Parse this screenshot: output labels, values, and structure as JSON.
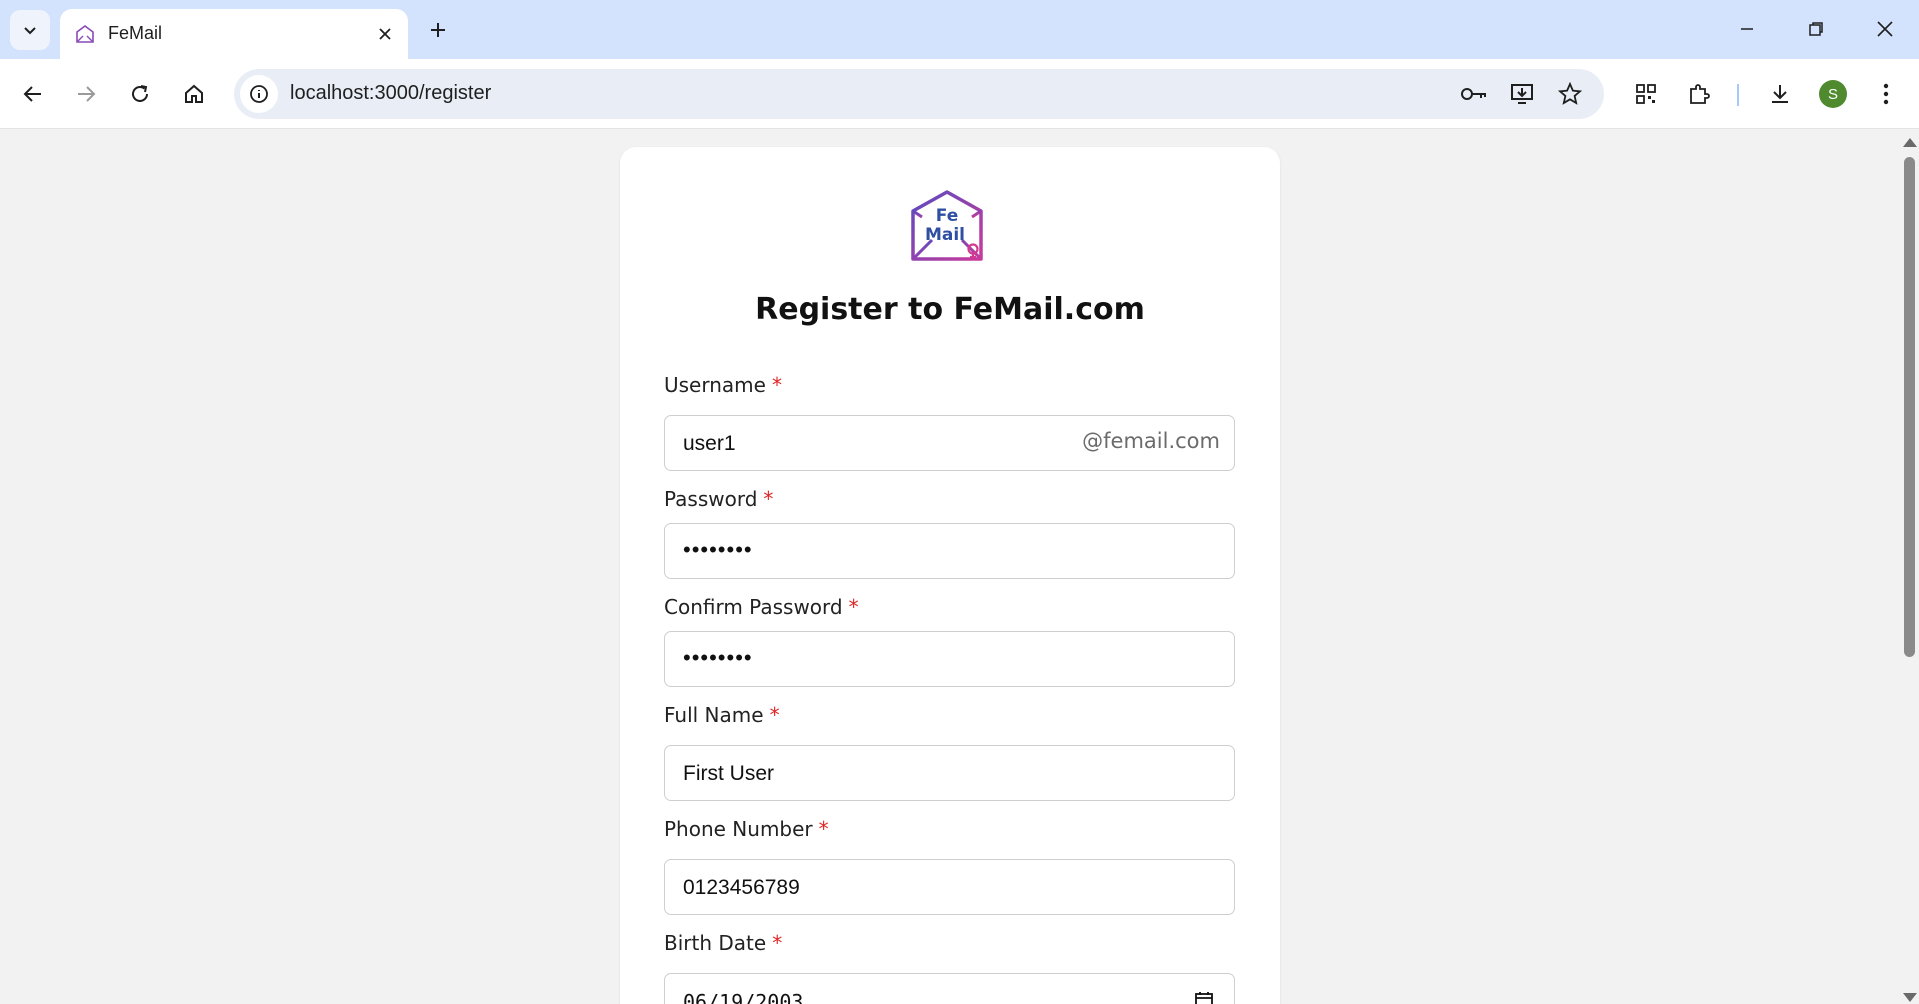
{
  "browser": {
    "tab_title": "FeMail",
    "url": "localhost:3000/register",
    "profile_initial": "S"
  },
  "form": {
    "title": "Register to FeMail.com",
    "logo_text_top": "Fe",
    "logo_text_bottom": "Mail",
    "required_mark": "*",
    "username": {
      "label": "Username",
      "value": "user1",
      "suffix": "@femail.com"
    },
    "password": {
      "label": "Password",
      "value": "••••••••"
    },
    "confirm_password": {
      "label": "Confirm Password",
      "value": "••••••••"
    },
    "full_name": {
      "label": "Full Name",
      "value": "First User"
    },
    "phone": {
      "label": "Phone Number",
      "value": "0123456789"
    },
    "birth_date": {
      "label": "Birth Date",
      "value": "06/19/2003"
    }
  },
  "colors": {
    "accent_purple": "#7b3fa6",
    "accent_blue": "#2f4fa3",
    "accent_pink": "#d33a8f",
    "required_red": "#e02424"
  }
}
